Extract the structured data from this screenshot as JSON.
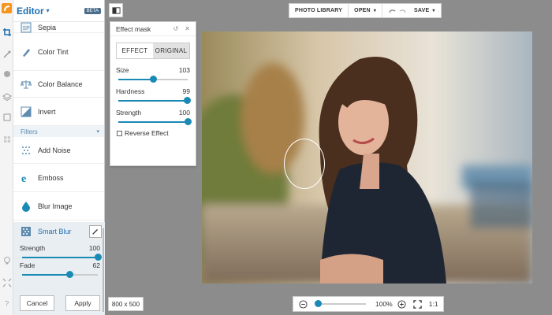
{
  "panel": {
    "title": "Editor",
    "beta": "BETA",
    "items": [
      {
        "label": "Sepia",
        "icon": "sepia-icon"
      },
      {
        "label": "Color Tint",
        "icon": "color-tint-icon"
      },
      {
        "label": "Color Balance",
        "icon": "balance-scale-icon"
      },
      {
        "label": "Invert",
        "icon": "invert-icon"
      }
    ],
    "section": "Filters",
    "filters": [
      {
        "label": "Add Noise",
        "icon": "noise-icon"
      },
      {
        "label": "Emboss",
        "icon": "emboss-icon"
      },
      {
        "label": "Blur Image",
        "icon": "drop-icon"
      }
    ],
    "smart_blur": {
      "label": "Smart Blur",
      "strength_label": "Strength",
      "strength_value": "100",
      "strength_fraction": 1.0,
      "fade_label": "Fade",
      "fade_value": "62",
      "fade_fraction": 0.62,
      "cancel": "Cancel",
      "apply": "Apply"
    }
  },
  "toolbar": {
    "photo_library": "PHOTO LIBRARY",
    "open": "OPEN",
    "save": "SAVE"
  },
  "mask": {
    "title": "Effect mask",
    "tab_effect": "EFFECT",
    "tab_original": "ORIGINAL",
    "size_label": "Size",
    "size_value": "103",
    "size_fraction": 0.5,
    "hardness_label": "Hardness",
    "hardness_value": "99",
    "hardness_fraction": 0.99,
    "strength_label": "Strength",
    "strength_value": "100",
    "strength_fraction": 1.0,
    "reverse_label": "Reverse Effect"
  },
  "status": {
    "dimensions": "800 x 500",
    "zoom": "100%",
    "zoom_fraction": 0.05,
    "ratio": "1:1"
  },
  "colors": {
    "accent": "#1a8ab5",
    "title": "#1f6fb2"
  }
}
